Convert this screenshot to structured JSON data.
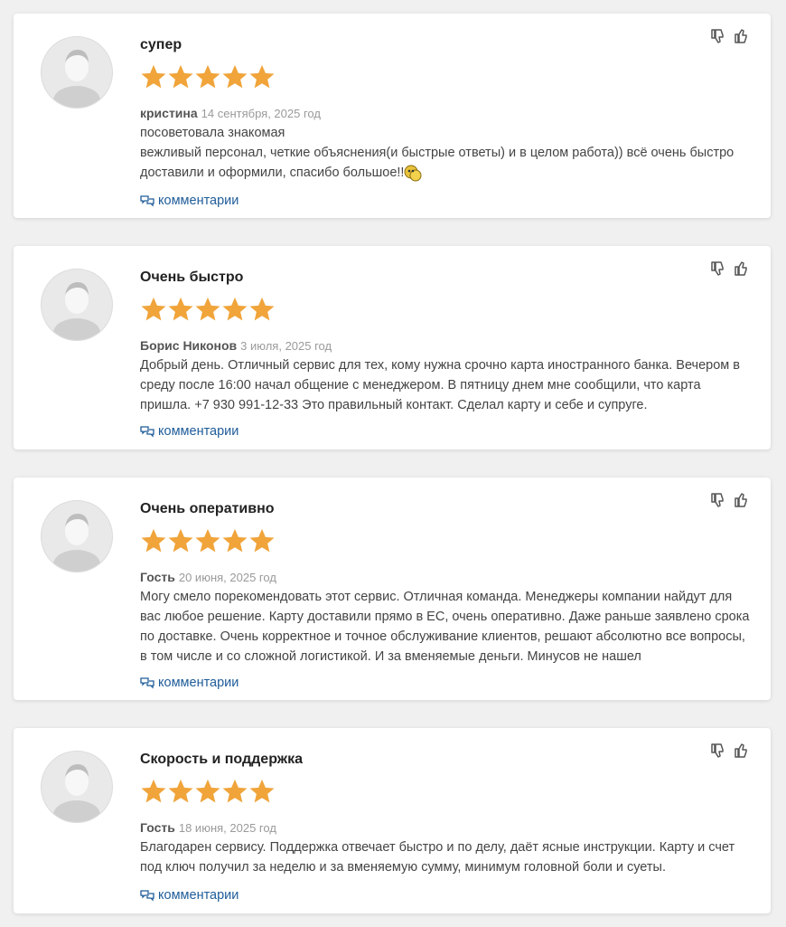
{
  "reviews": [
    {
      "title": "супер",
      "rating": 5,
      "author": "кристина",
      "date": "14 сентября, 2025 год",
      "lines": [
        "посоветовала знакомая",
        "вежливый персонал, четкие объяснения(и быстрые ответы) и в целом работа)) всё очень быстро доставили и оформили, спасибо большое!!"
      ],
      "comments_label": "комментарии"
    },
    {
      "title": "Очень быстро",
      "rating": 5,
      "author": "Борис Никонов",
      "date": "3 июля, 2025 год",
      "lines": [
        "Добрый день. Отличный сервис для тех, кому нужна срочно карта иностранного банка. Вечером в среду после 16:00 начал общение с менеджером. В пятницу днем мне сообщили, что карта пришла. +7 930 991-12-33 Это правильный контакт. Сделал карту и себе и супруге."
      ],
      "comments_label": "комментарии"
    },
    {
      "title": "Очень оперативно",
      "rating": 5,
      "author": "Гость",
      "date": "20 июня, 2025 год",
      "lines": [
        "Могу смело порекомендовать этот сервис. Отличная команда. Менеджеры компании найдут для вас любое решение. Карту доставили прямо в ЕС, очень оперативно. Даже раньше заявлено срока по доставке. Очень корректное и точное обслуживание клиентов, решают абсолютно все вопросы, в том числе и со сложной логистикой. И за вменяемые деньги. Минусов не нашел"
      ],
      "comments_label": "комментарии"
    },
    {
      "title": "Скорость и поддержка",
      "rating": 5,
      "author": "Гость",
      "date": "18 июня, 2025 год",
      "lines": [
        "Благодарен сервису. Поддержка отвечает быстро и по делу, даёт ясные инструкции. Карту и счет под ключ получил за неделю и за вменяемую сумму, минимум головной боли и суеты."
      ],
      "comments_label": "комментарии"
    }
  ],
  "icons": {
    "avatar": "user-silhouette-icon",
    "star": "star-icon",
    "comments": "speech-bubbles-icon",
    "dislike": "thumbs-down-icon",
    "like": "thumbs-up-icon",
    "emoji": "money-emoji-icon"
  },
  "colors": {
    "star": "#f0a43a",
    "link": "#1f5c99"
  }
}
